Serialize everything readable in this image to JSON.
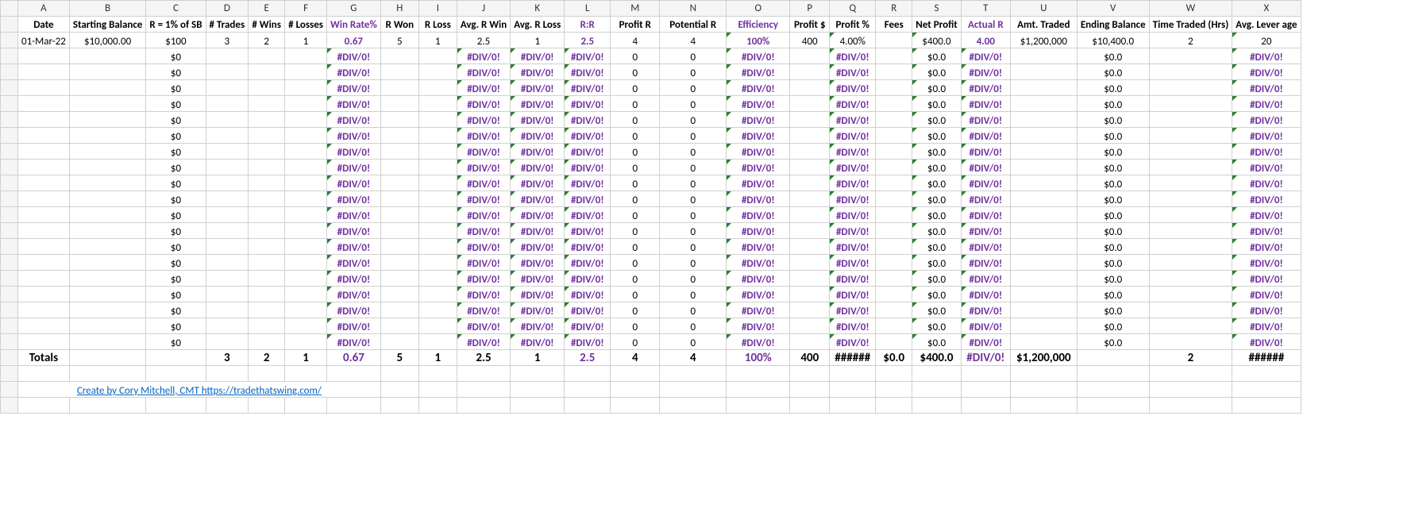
{
  "columns": [
    "A",
    "B",
    "C",
    "D",
    "E",
    "F",
    "G",
    "H",
    "I",
    "J",
    "K",
    "L",
    "M",
    "N",
    "O",
    "P",
    "Q",
    "R",
    "S",
    "T",
    "U",
    "V",
    "W",
    "X"
  ],
  "headers": {
    "A": "Date",
    "B": "Starting Balance",
    "C": "R = 1% of SB",
    "D": "# Trades",
    "E": "# Wins",
    "F": "# Losses",
    "G": "Win Rate%",
    "H": "R Won",
    "I": "R Loss",
    "J": "Avg. R Win",
    "K": "Avg. R Loss",
    "L": "R:R",
    "M": "Profit R",
    "N": "Potential R",
    "O": "Efficiency",
    "P": "Profit $",
    "Q": "Profit %",
    "R": "Fees",
    "S": "Net Profit",
    "T": "Actual R",
    "U": "Amt. Traded",
    "V": "Ending Balance",
    "W": "Time Traded (Hrs)",
    "X": "Avg. Lever age"
  },
  "purpleHeaders": [
    "G",
    "L",
    "O",
    "T"
  ],
  "firstRow": {
    "A": "01-Mar-22",
    "B": "$10,000.00",
    "C": "$100",
    "D": "3",
    "E": "2",
    "F": "1",
    "G": "0.67",
    "H": "5",
    "I": "1",
    "J": "2.5",
    "K": "1",
    "L": "2.5",
    "M": "4",
    "N": "4",
    "O": "100%",
    "P": "400",
    "Q": "4.00%",
    "R": "",
    "S": "$400.0",
    "T": "4.00",
    "U": "$1,200,000",
    "V": "$10,400.0",
    "W": "2",
    "X": "20"
  },
  "blankRow": {
    "A": "",
    "B": "",
    "C": "$0",
    "D": "",
    "E": "",
    "F": "",
    "G": "#DIV/0!",
    "H": "",
    "I": "",
    "J": "#DIV/0!",
    "K": "#DIV/0!",
    "L": "#DIV/0!",
    "M": "0",
    "N": "0",
    "O": "#DIV/0!",
    "P": "",
    "Q": "#DIV/0!",
    "R": "",
    "S": "$0.0",
    "T": "#DIV/0!",
    "U": "",
    "V": "$0.0",
    "W": "",
    "X": "#DIV/0!"
  },
  "blankCount": 19,
  "totals": {
    "label": "Totals",
    "A": "Totals",
    "B": "",
    "C": "",
    "D": "3",
    "E": "2",
    "F": "1",
    "G": "0.67",
    "H": "5",
    "I": "1",
    "J": "2.5",
    "K": "1",
    "L": "2.5",
    "M": "4",
    "N": "4",
    "O": "100%",
    "P": "400",
    "Q": "######",
    "R": "$0.0",
    "S": "$400.0",
    "T": "#DIV/0!",
    "U": "$1,200,000",
    "V": "",
    "W": "2",
    "X": "######"
  },
  "footer": {
    "text": "Create by Cory Mitchell, CMT https://tradethatswing.com/"
  },
  "errorCols": [
    "G",
    "J",
    "K",
    "L",
    "O",
    "Q",
    "T",
    "X"
  ],
  "firstRowWarnCols": [
    "O",
    "Q",
    "S",
    "X"
  ],
  "blankRowWarnCols": [
    "O",
    "Q",
    "S",
    "X"
  ]
}
